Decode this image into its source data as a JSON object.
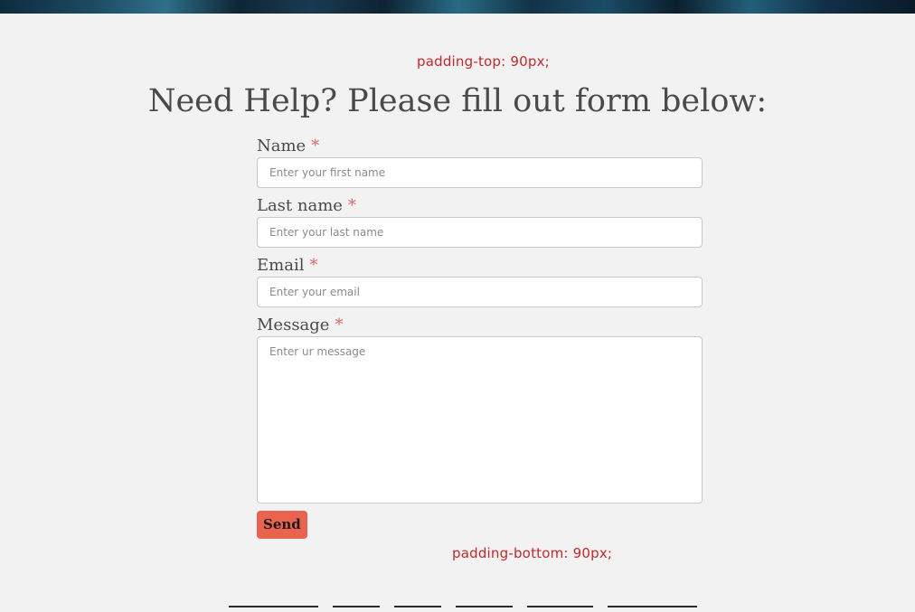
{
  "annotations": {
    "top": "padding-top: 90px;",
    "bottom": "padding-bottom: 90px;"
  },
  "title": "Need Help? Please fill out form below:",
  "form": {
    "required_marker": "*",
    "fields": [
      {
        "label": "Name",
        "placeholder": "Enter your first name",
        "value": ""
      },
      {
        "label": "Last name",
        "placeholder": "Enter your last name",
        "value": ""
      },
      {
        "label": "Email",
        "placeholder": "Enter your email",
        "value": ""
      },
      {
        "label": "Message",
        "placeholder": "Enter ur message",
        "value": ""
      }
    ],
    "submit_label": "Send"
  },
  "colors": {
    "background": "#f3f2f2",
    "annotation": "#c62828",
    "required": "#e06666",
    "button": "#e9634f"
  }
}
